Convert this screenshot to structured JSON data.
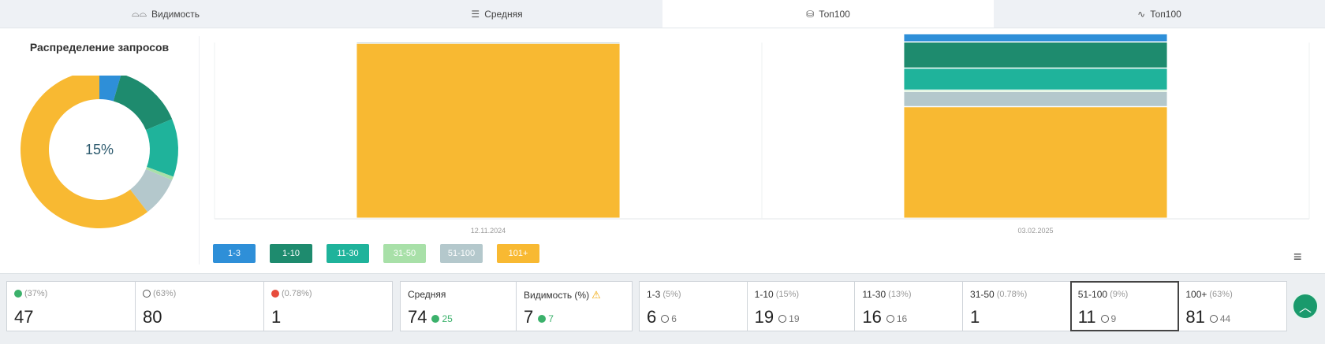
{
  "tabs": [
    {
      "icon": "glasses-icon",
      "glyph": "⌓⌓",
      "label": "Видимость"
    },
    {
      "icon": "list-icon",
      "glyph": "☰",
      "label": "Средняя"
    },
    {
      "icon": "database-icon",
      "glyph": "⛁",
      "label": "Топ100"
    },
    {
      "icon": "trend-icon",
      "glyph": "∿",
      "label": "Топ100"
    }
  ],
  "donut": {
    "title": "Распределение запросов",
    "center_label": "15%"
  },
  "chart_data": [
    {
      "type": "pie",
      "title": "Распределение запросов",
      "categories": [
        "1-3",
        "1-10",
        "11-30",
        "31-50",
        "51-100",
        "101+"
      ],
      "values": [
        6,
        19,
        16,
        1,
        11,
        81
      ],
      "colors": [
        "#2e8fd8",
        "#1e8b6e",
        "#1fb39b",
        "#a8e0a8",
        "#b4c8cc",
        "#f8b932"
      ]
    },
    {
      "type": "bar",
      "stacked": true,
      "categories": [
        "12.11.2024",
        "03.02.2025"
      ],
      "series": [
        {
          "name": "1-3",
          "color": "#2e8fd8",
          "values": [
            0,
            6
          ]
        },
        {
          "name": "1-10",
          "color": "#1e8b6e",
          "values": [
            0,
            19
          ]
        },
        {
          "name": "11-30",
          "color": "#1fb39b",
          "values": [
            0,
            16
          ]
        },
        {
          "name": "31-50",
          "color": "#a8e0a8",
          "values": [
            0,
            1
          ]
        },
        {
          "name": "51-100",
          "color": "#b4c8cc",
          "values": [
            1,
            11
          ]
        },
        {
          "name": "101+",
          "color": "#f8b932",
          "values": [
            127,
            81
          ]
        }
      ],
      "ylim": [
        0,
        128
      ]
    }
  ],
  "legend": [
    {
      "label": "1-3",
      "color": "#2e8fd8"
    },
    {
      "label": "1-10",
      "color": "#1e8b6e"
    },
    {
      "label": "11-30",
      "color": "#1fb39b"
    },
    {
      "label": "31-50",
      "color": "#a8e0a8"
    },
    {
      "label": "51-100",
      "color": "#b4c8cc"
    },
    {
      "label": "101+",
      "color": "#f8b932"
    }
  ],
  "x_ticks": [
    "12.11.2024",
    "03.02.2025"
  ],
  "stats": {
    "change": [
      {
        "icon": "up-icon",
        "pct": "(37%)",
        "value": "47"
      },
      {
        "icon": "neutral-icon",
        "pct": "(63%)",
        "value": "80"
      },
      {
        "icon": "down-icon",
        "pct": "(0.78%)",
        "value": "1"
      }
    ],
    "avg": {
      "label": "Средняя",
      "value": "74",
      "delta": "25"
    },
    "vis": {
      "label": "Видимость (%)",
      "value": "7",
      "delta": "7"
    },
    "ranges": [
      {
        "label": "1-3",
        "pct": "(5%)",
        "value": "6",
        "prev": "6"
      },
      {
        "label": "1-10",
        "pct": "(15%)",
        "value": "19",
        "prev": "19"
      },
      {
        "label": "11-30",
        "pct": "(13%)",
        "value": "16",
        "prev": "16"
      },
      {
        "label": "31-50",
        "pct": "(0.78%)",
        "value": "1",
        "prev": ""
      },
      {
        "label": "51-100",
        "pct": "(9%)",
        "value": "11",
        "prev": "9"
      },
      {
        "label": "100+",
        "pct": "(63%)",
        "value": "81",
        "prev": "44"
      }
    ]
  },
  "colors": {
    "accent": "#1a9a6c",
    "warning": "#f0a500",
    "positive": "#3bb16b",
    "negative": "#e74c3c"
  }
}
